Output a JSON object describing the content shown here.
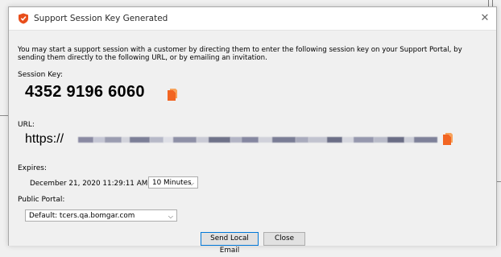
{
  "window": {
    "title": "Support Session Key Generated",
    "close_glyph": "✕",
    "icon": "bomgar-shield-icon"
  },
  "description": "You may start a support session with a customer by directing them to enter the following session key on your Support Portal, by sending them directly to the following URL, or by emailing an invitation.",
  "session_key": {
    "label": "Session Key:",
    "value": "4352 9196 6060"
  },
  "url": {
    "label": "URL:",
    "prefix": "https://"
  },
  "expires": {
    "label": "Expires:",
    "value": "December 21, 2020 11:29:11 AM",
    "duration_selected": "10 Minutes"
  },
  "public_portal": {
    "label": "Public Portal:",
    "selected": "Default: tcers.qa.bomgar.com"
  },
  "buttons": {
    "send_email": "Send Local Email",
    "close": "Close"
  },
  "colors": {
    "accent_copy_icon": "#f26522",
    "focus_border": "#0078d7"
  }
}
